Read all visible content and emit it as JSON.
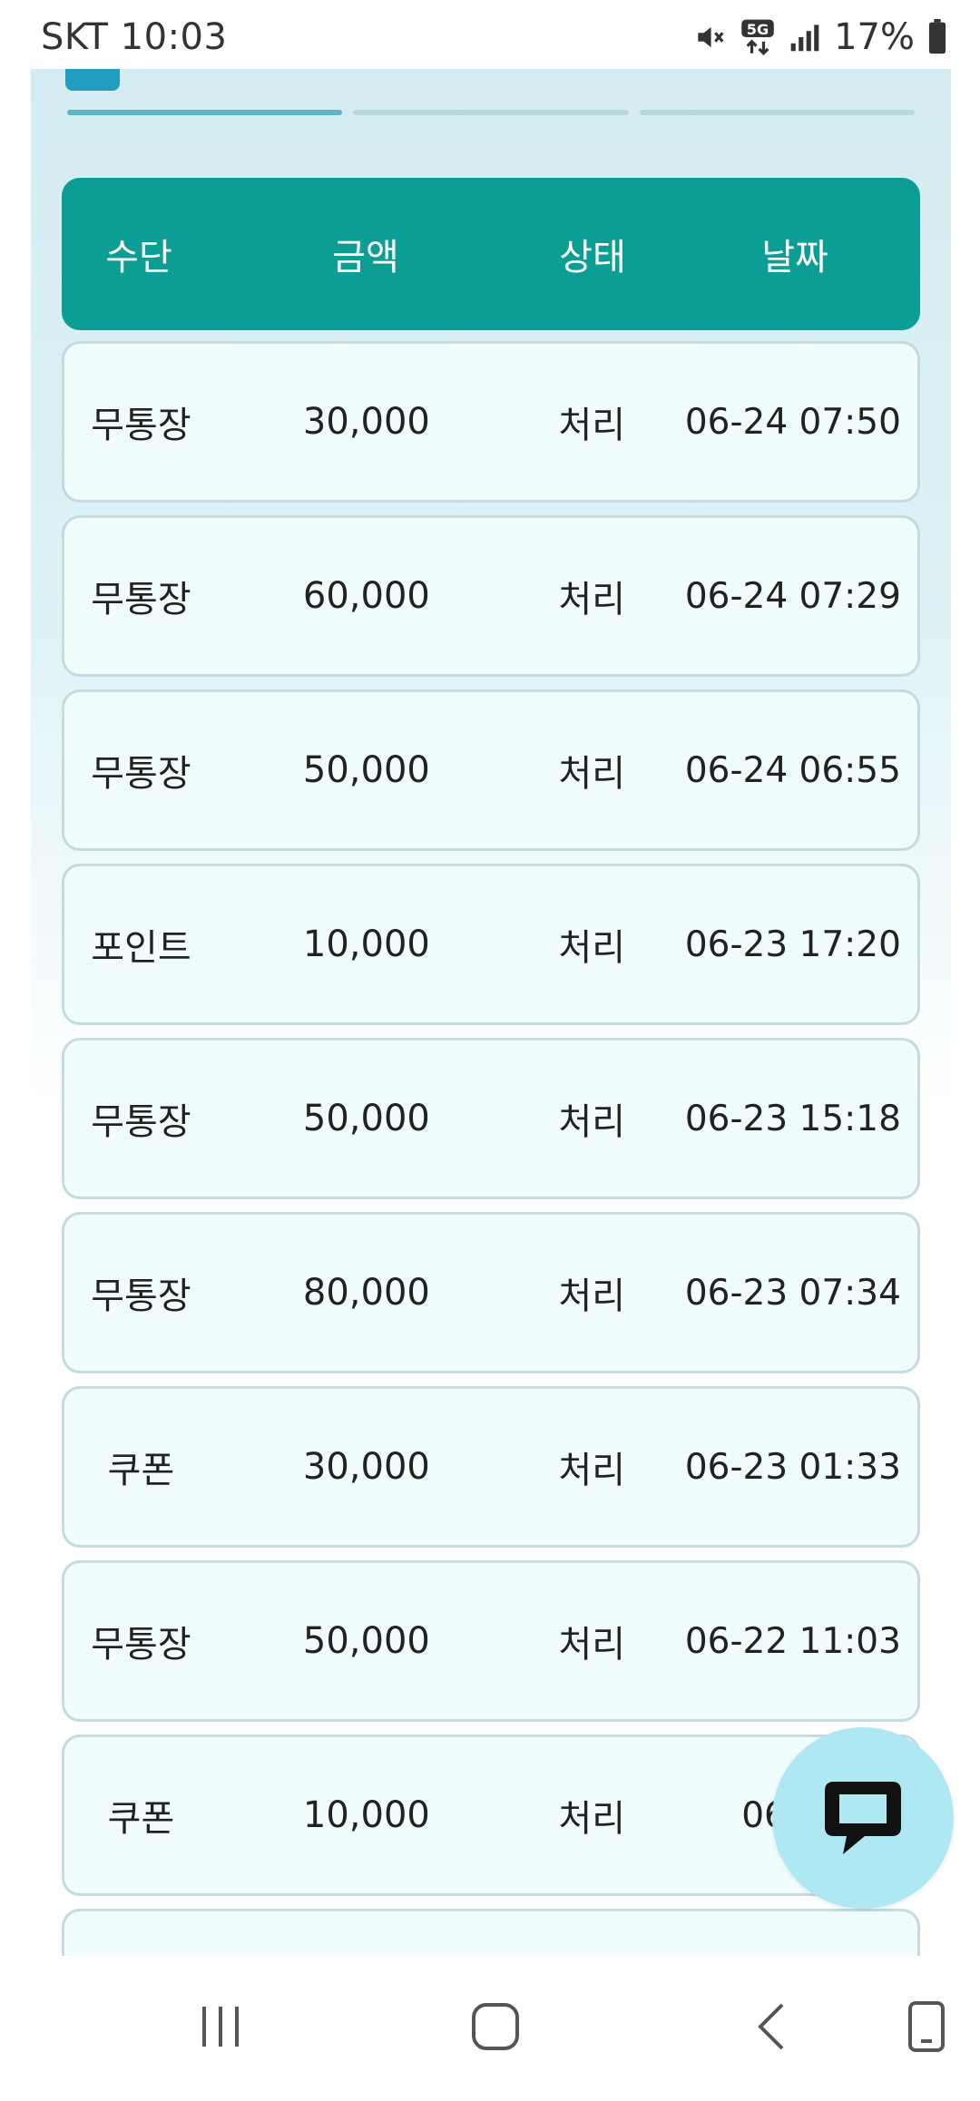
{
  "status_bar": {
    "time": "SKT 10:03",
    "network": "5G",
    "battery": "17%"
  },
  "table": {
    "headers": [
      "수단",
      "금액",
      "상태",
      "날짜"
    ],
    "rows": [
      {
        "method": "무통장",
        "amount": "30,000",
        "status": "처리",
        "date": "06-24 07:50"
      },
      {
        "method": "무통장",
        "amount": "60,000",
        "status": "처리",
        "date": "06-24 07:29"
      },
      {
        "method": "무통장",
        "amount": "50,000",
        "status": "처리",
        "date": "06-24 06:55"
      },
      {
        "method": "포인트",
        "amount": "10,000",
        "status": "처리",
        "date": "06-23 17:20"
      },
      {
        "method": "무통장",
        "amount": "50,000",
        "status": "처리",
        "date": "06-23 15:18"
      },
      {
        "method": "무통장",
        "amount": "80,000",
        "status": "처리",
        "date": "06-23 07:34"
      },
      {
        "method": "쿠폰",
        "amount": "30,000",
        "status": "처리",
        "date": "06-23 01:33"
      },
      {
        "method": "무통장",
        "amount": "50,000",
        "status": "처리",
        "date": "06-22 11:03"
      },
      {
        "method": "쿠폰",
        "amount": "10,000",
        "status": "처리",
        "date": "06-22"
      },
      {
        "method": "",
        "amount": "",
        "status": "",
        "date": ""
      }
    ]
  },
  "icons": {
    "chat": "chat-bubble-icon",
    "recents": "recent-apps-icon",
    "home": "home-icon",
    "back": "back-icon",
    "keyboard": "keyboard-toggle-icon"
  },
  "colors": {
    "header_bg": "#0c9e95",
    "row_bg": "#f1fdfd",
    "fab_bg": "#aee8f3"
  }
}
